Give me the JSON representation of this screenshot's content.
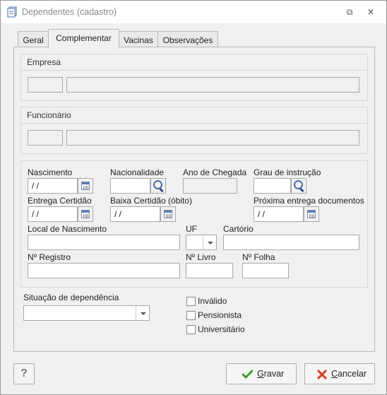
{
  "window": {
    "title": "Dependentes (cadastro)",
    "restore_glyph": "⧉",
    "close_glyph": "✕"
  },
  "tabs": [
    {
      "label": "Geral",
      "active": false
    },
    {
      "label": "Complementar",
      "active": true
    },
    {
      "label": "Vacinas",
      "active": false
    },
    {
      "label": "Observações",
      "active": false
    }
  ],
  "empresa": {
    "title": "Empresa",
    "code": "",
    "name": ""
  },
  "funcionario": {
    "title": "Funcionário",
    "code": "",
    "name": ""
  },
  "form": {
    "nascimento": {
      "label": "Nascimento",
      "value": " / /"
    },
    "nacionalidade": {
      "label": "Nacionalidade",
      "value": ""
    },
    "ano_chegada": {
      "label": "Ano de Chegada",
      "value": ""
    },
    "grau_instrucao": {
      "label": "Grau de instrução",
      "value": ""
    },
    "entrega_certidao": {
      "label": "Entrega Certidão",
      "value": " / /"
    },
    "baixa_certidao": {
      "label": "Baixa Certidão (óbito)",
      "value": " / /"
    },
    "proxima_entrega": {
      "label": "Próxima entrega documentos",
      "value": " / /"
    },
    "local_nascimento": {
      "label": "Local de Nascimento",
      "value": ""
    },
    "uf": {
      "label": "UF",
      "value": ""
    },
    "cartorio": {
      "label": "Cartório",
      "value": ""
    },
    "n_registro": {
      "label": "Nº Registro",
      "value": ""
    },
    "n_livro": {
      "label": "Nº Livro",
      "value": ""
    },
    "n_folha": {
      "label": "Nº Folha",
      "value": ""
    }
  },
  "situacao": {
    "label": "Situação de dependência",
    "value": ""
  },
  "checkboxes": {
    "invalido": "Inválido",
    "pensionista": "Pensionista",
    "universitario": "Universitário"
  },
  "buttons": {
    "help": "?",
    "gravar": "Gravar",
    "gravar_mnemonic": "G",
    "gravar_rest": "ravar",
    "cancelar_mnemonic": "C",
    "cancelar_rest": "ancelar"
  },
  "colors": {
    "accent_blue": "#4b6ea8",
    "save_green": "#3a9a2a",
    "cancel_red": "#d04a2a"
  }
}
